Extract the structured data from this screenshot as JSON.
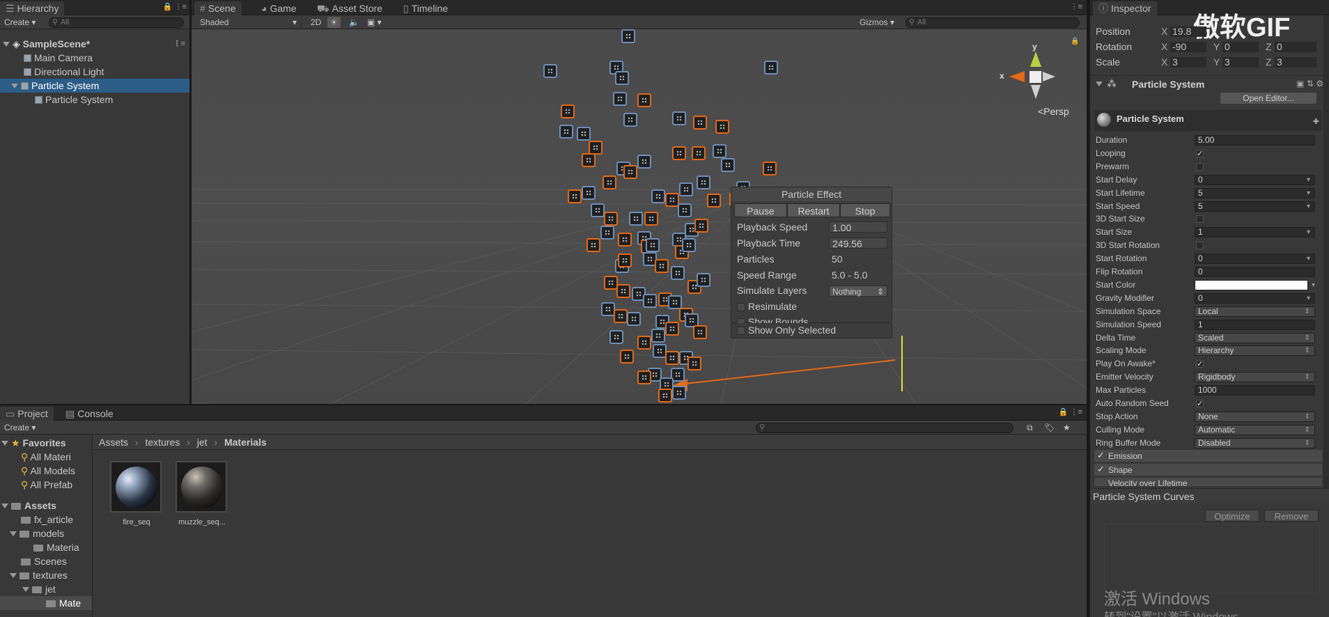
{
  "hierarchy": {
    "tab_label": "Hierarchy",
    "create_label": "Create",
    "search_placeholder": "All",
    "scene_name": "SampleScene*",
    "items": [
      "Main Camera",
      "Directional Light",
      "Particle System",
      "Particle System"
    ]
  },
  "scene": {
    "tabs": [
      "Scene",
      "Game",
      "Asset Store",
      "Timeline"
    ],
    "shading_mode": "Shaded",
    "mode_2d": "2D",
    "gizmos_label": "Gizmos",
    "search_placeholder": "All",
    "persp_label": "<Persp",
    "axis_x": "x",
    "axis_y": "y"
  },
  "particle_effect": {
    "title": "Particle Effect",
    "buttons": [
      "Pause",
      "Restart",
      "Stop"
    ],
    "playback_speed_label": "Playback Speed",
    "playback_speed_value": "1.00",
    "playback_time_label": "Playback Time",
    "playback_time_value": "249.56",
    "particles_label": "Particles",
    "particles_value": "50",
    "speed_range_label": "Speed Range",
    "speed_range_value": "5.0 - 5.0",
    "simulate_layers_label": "Simulate Layers",
    "simulate_layers_value": "Nothing",
    "checkboxes": [
      "Resimulate",
      "Show Bounds",
      "Show Only Selected"
    ]
  },
  "inspector": {
    "tab_label": "Inspector",
    "watermark": "傲软GIF",
    "transform": {
      "position_label": "Position",
      "position_x": "19.8",
      "rotation_label": "Rotation",
      "rotation_x": "-90",
      "rotation_y": "0",
      "rotation_z": "0",
      "scale_label": "Scale",
      "scale_x": "3",
      "scale_y": "3",
      "scale_z": "3"
    },
    "component_title": "Particle System",
    "open_editor_label": "Open Editor...",
    "module_title": "Particle System",
    "properties": [
      {
        "label": "Duration",
        "value": "5.00",
        "kind": "field"
      },
      {
        "label": "Looping",
        "value": "✓",
        "kind": "check"
      },
      {
        "label": "Prewarm",
        "value": "",
        "kind": "check"
      },
      {
        "label": "Start Delay",
        "value": "0",
        "kind": "curve"
      },
      {
        "label": "Start Lifetime",
        "value": "5",
        "kind": "curve"
      },
      {
        "label": "Start Speed",
        "value": "5",
        "kind": "curve"
      },
      {
        "label": "3D Start Size",
        "value": "",
        "kind": "check"
      },
      {
        "label": "Start Size",
        "value": "1",
        "kind": "curve"
      },
      {
        "label": "3D Start Rotation",
        "value": "",
        "kind": "check"
      },
      {
        "label": "Start Rotation",
        "value": "0",
        "kind": "curve"
      },
      {
        "label": "Flip Rotation",
        "value": "0",
        "kind": "field"
      },
      {
        "label": "Start Color",
        "value": "",
        "kind": "color"
      },
      {
        "label": "Gravity Modifier",
        "value": "0",
        "kind": "curve"
      },
      {
        "label": "Simulation Space",
        "value": "Local",
        "kind": "enum"
      },
      {
        "label": "Simulation Speed",
        "value": "1",
        "kind": "field"
      },
      {
        "label": "Delta Time",
        "value": "Scaled",
        "kind": "enum"
      },
      {
        "label": "Scaling Mode",
        "value": "Hierarchy",
        "kind": "enum"
      },
      {
        "label": "Play On Awake*",
        "value": "✓",
        "kind": "check"
      },
      {
        "label": "Emitter Velocity",
        "value": "Rigidbody",
        "kind": "enum"
      },
      {
        "label": "Max Particles",
        "value": "1000",
        "kind": "field"
      },
      {
        "label": "Auto Random Seed",
        "value": "✓",
        "kind": "check"
      },
      {
        "label": "Stop Action",
        "value": "None",
        "kind": "enum"
      },
      {
        "label": "Culling Mode",
        "value": "Automatic",
        "kind": "enum"
      },
      {
        "label": "Ring Buffer Mode",
        "value": "Disabled",
        "kind": "enum"
      }
    ],
    "modules": [
      "Emission",
      "Shape",
      "Velocity over Lifetime"
    ],
    "curves_title": "Particle System Curves",
    "optimize_label": "Optimize",
    "remove_label": "Remove",
    "windows_watermark": "激活 Windows",
    "windows_watermark_sub": "转到\"设置\"以激活 Windows"
  },
  "project": {
    "tabs": [
      "Project",
      "Console"
    ],
    "create_label": "Create",
    "favorites_label": "Favorites",
    "favorites": [
      "All Materi",
      "All Models",
      "All Prefab"
    ],
    "assets_label": "Assets",
    "asset_tree": [
      "fx_article",
      "models",
      "Materia",
      "Scenes",
      "textures",
      "jet",
      "Mate"
    ],
    "breadcrumb": [
      "Assets",
      "textures",
      "jet",
      "Materials"
    ],
    "assets": [
      "fire_seq",
      "muzzle_seq..."
    ]
  },
  "colors": {
    "selection": "#2c5d87",
    "particle_orange": "#e36a16",
    "particle_blue": "#6e8fb7"
  }
}
